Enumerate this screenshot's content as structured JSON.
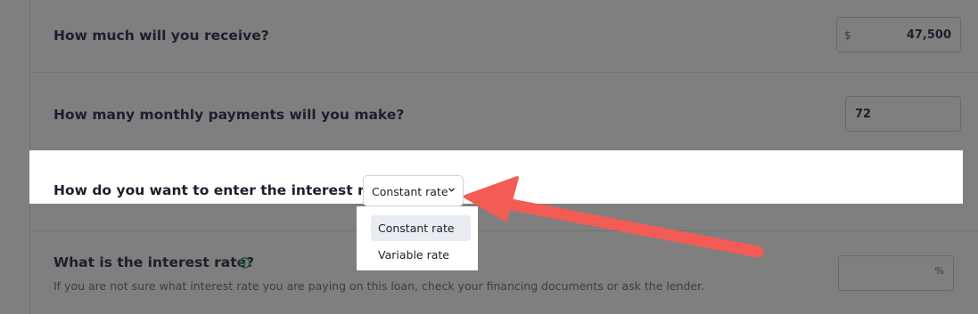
{
  "receive": {
    "question": "How much will you receive?",
    "prefix": "$",
    "value": "47,500"
  },
  "payments": {
    "question": "How many monthly payments will you make?",
    "value": "72"
  },
  "rate_entry": {
    "question": "How do you want to enter the interest rate?",
    "selected": "Constant rate",
    "options": [
      "Constant rate",
      "Variable rate"
    ]
  },
  "interest": {
    "question": "What is the interest rate?",
    "help": "If you are not sure what interest rate you are paying on this loan, check your financing documents or ask the lender.",
    "suffix": "%",
    "value": ""
  },
  "colors": {
    "arrow": "#f25c54",
    "overlay": "#7f7f7f",
    "highlight": "#ffffff"
  },
  "icons": [
    "chevron-down-icon",
    "info-circle-icon",
    "annotation-arrow"
  ]
}
